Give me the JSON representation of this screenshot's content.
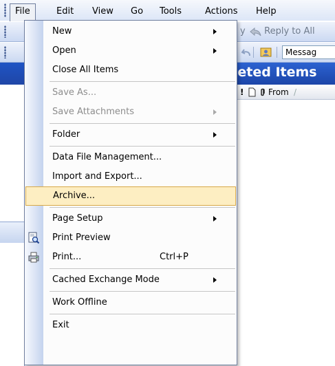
{
  "menubar": {
    "items": [
      {
        "label": "File"
      },
      {
        "label": "Edit"
      },
      {
        "label": "View"
      },
      {
        "label": "Go"
      },
      {
        "label": "Tools"
      },
      {
        "label": "Actions"
      },
      {
        "label": "Help"
      }
    ]
  },
  "toolbar": {
    "reply_fragment": "y",
    "reply_all_label": "Reply to All",
    "search_text": "Messag"
  },
  "folder": {
    "title": "eleted Items",
    "columns": {
      "from": "From"
    }
  },
  "file_menu": {
    "items": [
      {
        "label": "New",
        "submenu": true
      },
      {
        "label": "Open",
        "submenu": true
      },
      {
        "label": "Close All Items"
      },
      {
        "label": "Save As...",
        "disabled": true
      },
      {
        "label": "Save Attachments",
        "disabled": true,
        "submenu": true
      },
      {
        "label": "Folder",
        "submenu": true
      },
      {
        "label": "Data File Management..."
      },
      {
        "label": "Import and Export..."
      },
      {
        "label": "Archive...",
        "highlighted": true
      },
      {
        "label": "Page Setup",
        "submenu": true
      },
      {
        "label": "Print Preview",
        "icon": "print-preview-icon"
      },
      {
        "label": "Print...",
        "shortcut": "Ctrl+P",
        "icon": "printer-icon"
      },
      {
        "label": "Cached Exchange Mode",
        "submenu": true
      },
      {
        "label": "Work Offline"
      },
      {
        "label": "Exit"
      }
    ]
  },
  "colors": {
    "menu_highlight": "#fdeec2",
    "menu_highlight_border": "#d7a847",
    "header_blue": "#1f4fbf"
  }
}
